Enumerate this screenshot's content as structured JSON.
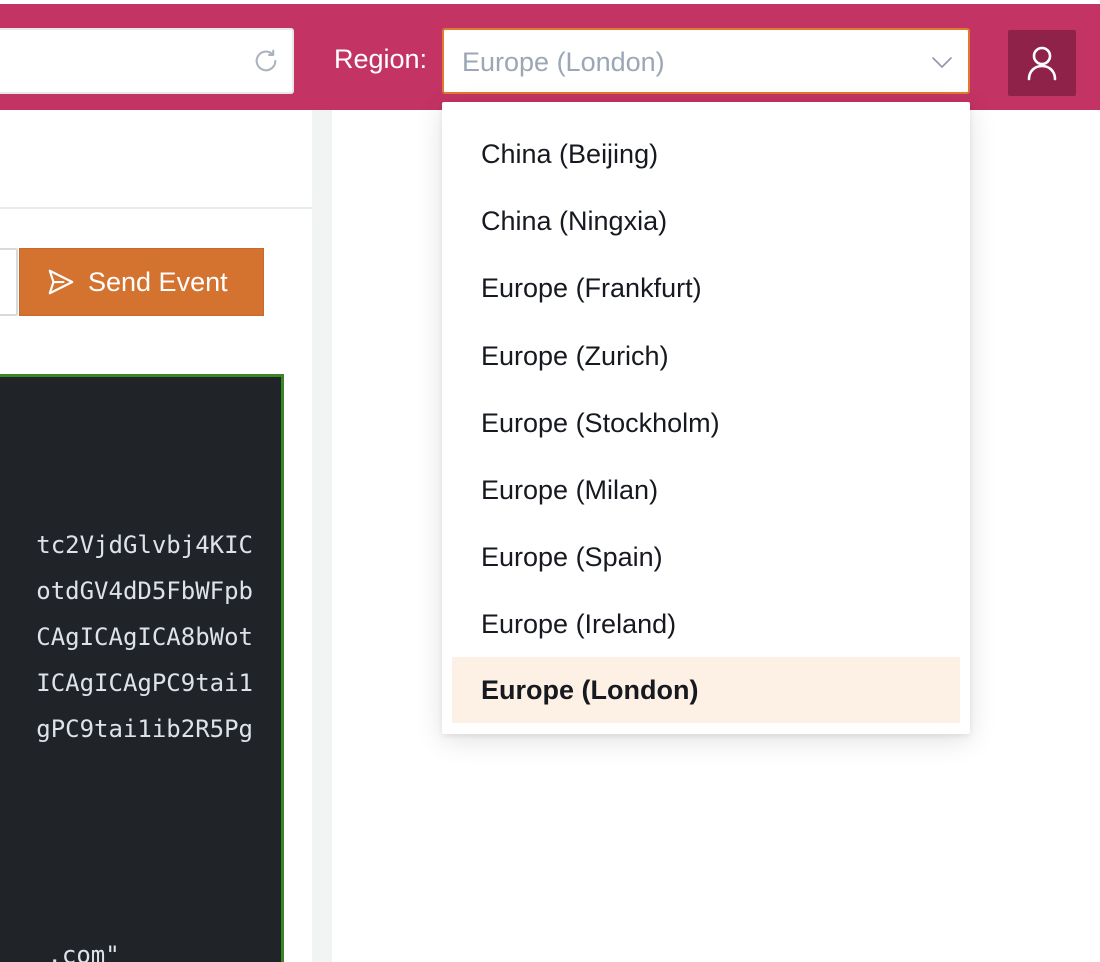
{
  "header": {
    "url_value": "",
    "region_label": "Region:",
    "region_selected": "Europe (London)",
    "accent_color": "#c33364",
    "icons": [
      "refresh-icon",
      "chevron-down-icon",
      "user-icon"
    ]
  },
  "actions": {
    "send_event_label": "Send Event",
    "send_icon": "send-icon",
    "button_color": "#d4722f"
  },
  "code": {
    "lines": [
      "tc2VjdGlvbj4KIC",
      "otdGV4dD5FbWFpb",
      "CAgICAgICA8bWot",
      "ICAgICAgPC9tai1",
      "gPC9tai1ib2R5Pg",
      " .com\""
    ]
  },
  "dropdown": {
    "options": [
      "China (Beijing)",
      "China (Ningxia)",
      "Europe (Frankfurt)",
      "Europe (Zurich)",
      "Europe (Stockholm)",
      "Europe (Milan)",
      "Europe (Spain)",
      "Europe (Ireland)",
      "Europe (London)"
    ],
    "selected_index": 8,
    "selected_bg": "#fdf1e5"
  }
}
